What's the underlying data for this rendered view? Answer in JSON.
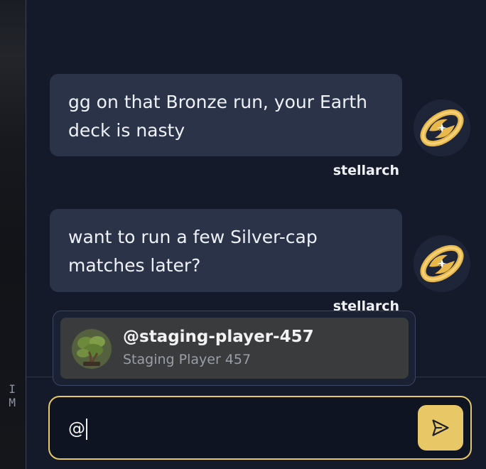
{
  "left_strip": {
    "glyph": "I M"
  },
  "messages": [
    {
      "text": "gg on that Bronze run, your Earth deck is nasty",
      "sender": "stellarch",
      "avatar_icon": "orbit-logo-icon"
    },
    {
      "text": "want to run a few Silver-cap matches later?",
      "sender": "stellarch",
      "avatar_icon": "orbit-logo-icon"
    }
  ],
  "mention_popup": {
    "items": [
      {
        "handle": "@staging-player-457",
        "display_name": "Staging Player 457",
        "avatar_icon": "bonsai-avatar-icon"
      }
    ]
  },
  "composer": {
    "value": "@",
    "send_icon": "send-icon"
  },
  "colors": {
    "background": "#141a29",
    "bubble": "#2b3349",
    "accent": "#e8c766",
    "popup_item": "#3a3b3d"
  }
}
